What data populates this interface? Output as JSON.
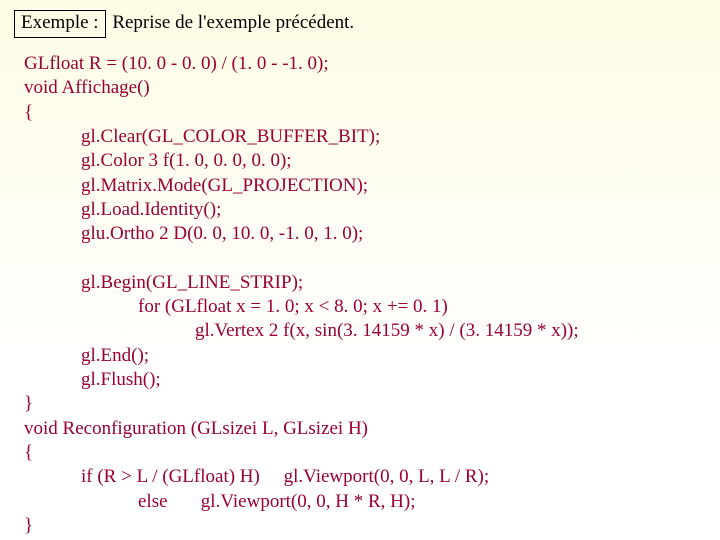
{
  "header": {
    "box_label": "Exemple :",
    "title_rest": "Reprise de l'exemple précédent."
  },
  "code": {
    "l01": "GLfloat R = (10. 0 - 0. 0) / (1. 0 - -1. 0);",
    "l02": "void Affichage()",
    "l03": "{",
    "l04": "            gl.Clear(GL_COLOR_BUFFER_BIT);",
    "l05": "            gl.Color 3 f(1. 0, 0. 0, 0. 0);",
    "l06": "            gl.Matrix.Mode(GL_PROJECTION);",
    "l07": "            gl.Load.Identity();",
    "l08": "            glu.Ortho 2 D(0. 0, 10. 0, -1. 0, 1. 0);",
    "l09": "",
    "l10": "            gl.Begin(GL_LINE_STRIP);",
    "l11": "                        for (GLfloat x = 1. 0; x < 8. 0; x += 0. 1)",
    "l12": "                                    gl.Vertex 2 f(x, sin(3. 14159 * x) / (3. 14159 * x));",
    "l13": "            gl.End();",
    "l14": "            gl.Flush();",
    "l15": "}",
    "l16": "void Reconfiguration (GLsizei L, GLsizei H)",
    "l17": "{",
    "l18": "            if (R > L / (GLfloat) H)     gl.Viewport(0, 0, L, L / R);",
    "l19": "                        else       gl.Viewport(0, 0, H * R, H);",
    "l20": "}"
  }
}
